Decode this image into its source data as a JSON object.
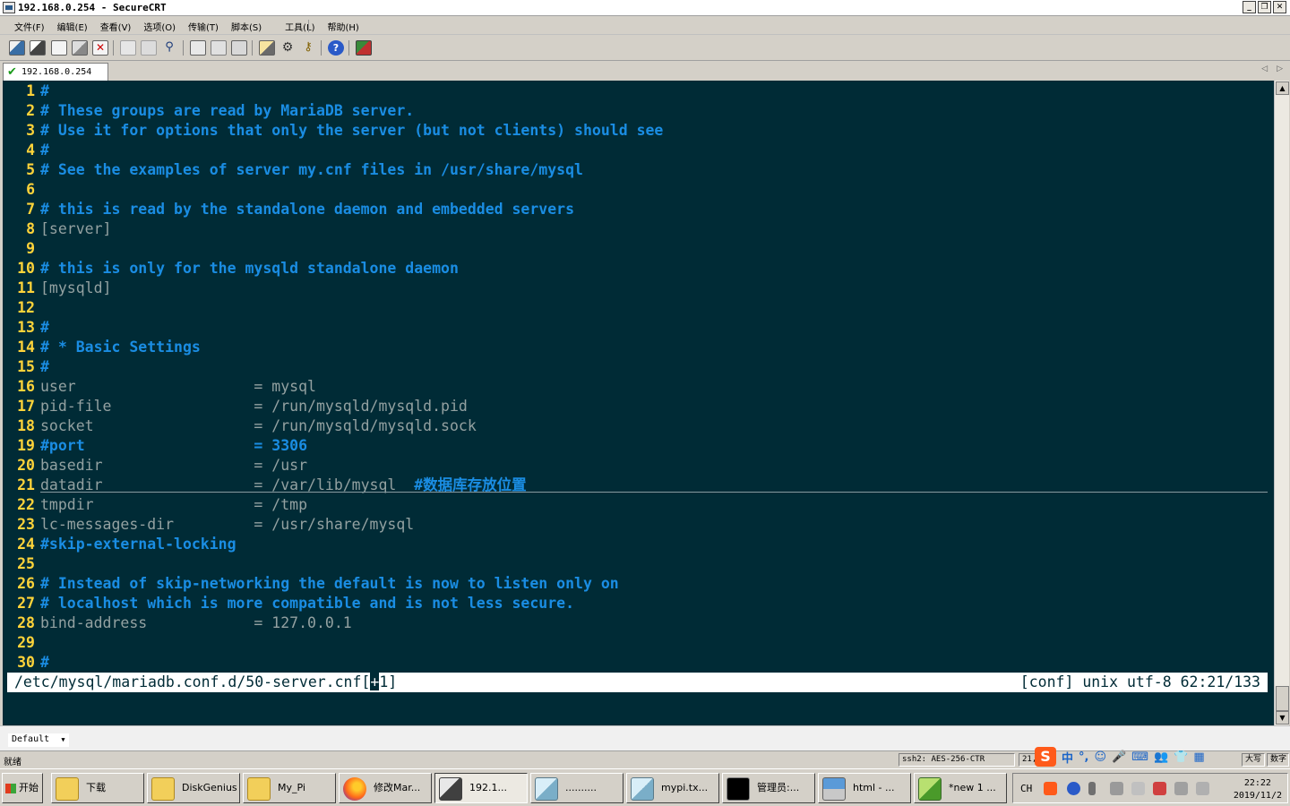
{
  "window": {
    "title": "192.168.0.254 - SecureCRT",
    "controls": [
      "_",
      "❐",
      "✕"
    ]
  },
  "menu": [
    "文件(F)",
    "编辑(E)",
    "查看(V)",
    "选项(O)",
    "传输(T)",
    "脚本(S)",
    "工具(L)",
    "帮助(H)"
  ],
  "toolbar": {
    "icons": [
      "connect-icon",
      "quick-connect-icon",
      "connect-tab-icon",
      "reconnect-icon",
      "disconnect-icon",
      "copy-icon",
      "paste-icon",
      "find-icon",
      "print-icon",
      "print-selection-icon",
      "print-setup-icon",
      "session-options-icon",
      "global-options-icon",
      "key-map-icon",
      "help-icon",
      "sftp-icon"
    ]
  },
  "tab": {
    "label": "192.168.0.254",
    "status_icon": "connected-check-icon"
  },
  "colors": {
    "terminal_bg": "#002b36",
    "line_number": "#ffd43a",
    "comment": "#1a8de3",
    "text": "#93a1a1"
  },
  "editor": {
    "lines": [
      {
        "n": "1",
        "segments": [
          {
            "t": "#",
            "c": "cm"
          }
        ]
      },
      {
        "n": "2",
        "segments": [
          {
            "t": "# These groups are read by MariaDB server.",
            "c": "cm"
          }
        ]
      },
      {
        "n": "3",
        "segments": [
          {
            "t": "# Use it for options that only the server (but not clients) should see",
            "c": "cm"
          }
        ]
      },
      {
        "n": "4",
        "segments": [
          {
            "t": "#",
            "c": "cm"
          }
        ]
      },
      {
        "n": "5",
        "segments": [
          {
            "t": "# See the examples of server my.cnf files in /usr/share/mysql",
            "c": "cm"
          }
        ]
      },
      {
        "n": "6",
        "segments": []
      },
      {
        "n": "7",
        "segments": [
          {
            "t": "# this is read by the standalone daemon and embedded servers",
            "c": "cm"
          }
        ]
      },
      {
        "n": "8",
        "segments": [
          {
            "t": "[server]",
            "c": "kw"
          }
        ]
      },
      {
        "n": "9",
        "segments": []
      },
      {
        "n": "10",
        "segments": [
          {
            "t": "# this is only for the mysqld standalone daemon",
            "c": "cm"
          }
        ]
      },
      {
        "n": "11",
        "segments": [
          {
            "t": "[mysqld]",
            "c": "kw"
          }
        ]
      },
      {
        "n": "12",
        "segments": []
      },
      {
        "n": "13",
        "segments": [
          {
            "t": "#",
            "c": "cm"
          }
        ]
      },
      {
        "n": "14",
        "segments": [
          {
            "t": "# * Basic Settings",
            "c": "cm"
          }
        ]
      },
      {
        "n": "15",
        "segments": [
          {
            "t": "#",
            "c": "cm"
          }
        ]
      },
      {
        "n": "16",
        "segments": [
          {
            "t": "user                    = mysql",
            "c": "kw"
          }
        ]
      },
      {
        "n": "17",
        "segments": [
          {
            "t": "pid-file                = /run/mysqld/mysqld.pid",
            "c": "kw"
          }
        ]
      },
      {
        "n": "18",
        "segments": [
          {
            "t": "socket                  = /run/mysqld/mysqld.sock",
            "c": "kw"
          }
        ]
      },
      {
        "n": "19",
        "segments": [
          {
            "t": "#port                   = 3306",
            "c": "cm"
          }
        ]
      },
      {
        "n": "20",
        "segments": [
          {
            "t": "basedir                 = /usr",
            "c": "kw"
          }
        ]
      },
      {
        "n": "21",
        "segments": [
          {
            "t": "datadir                 = /var/lib/mysql  ",
            "c": "kw"
          },
          {
            "t": "#数据库存放位置",
            "c": "hl"
          }
        ]
      },
      {
        "n": "22",
        "segments": [
          {
            "t": "tmpdir                  = /tmp",
            "c": "kw"
          }
        ]
      },
      {
        "n": "23",
        "segments": [
          {
            "t": "lc-messages-dir         = /usr/share/mysql",
            "c": "kw"
          }
        ]
      },
      {
        "n": "24",
        "segments": [
          {
            "t": "#skip-external-locking",
            "c": "cm"
          }
        ]
      },
      {
        "n": "25",
        "segments": []
      },
      {
        "n": "26",
        "segments": [
          {
            "t": "# Instead of skip-networking the default is now to listen only on",
            "c": "cm"
          }
        ]
      },
      {
        "n": "27",
        "segments": [
          {
            "t": "# localhost which is more compatible and is not less secure.",
            "c": "cm"
          }
        ]
      },
      {
        "n": "28",
        "segments": [
          {
            "t": "bind-address            = 127.0.0.1",
            "c": "kw"
          }
        ]
      },
      {
        "n": "29",
        "segments": []
      },
      {
        "n": "30",
        "segments": [
          {
            "t": "#",
            "c": "cm"
          }
        ]
      }
    ],
    "status_path_before": "/etc/mysql/mariadb.conf.d/50-server.cnf[",
    "status_cursor": "+",
    "status_path_after": "1]",
    "status_right": "[conf] unix utf-8 62:21/133"
  },
  "button_bar": {
    "selected": "Default"
  },
  "statusbar": {
    "ready": "就绪",
    "cipher": "ssh2: AES-256-CTR",
    "position": "21,",
    "caps": "大写",
    "num": "数字"
  },
  "ime": {
    "logo": "S",
    "chars": [
      "中",
      "°,",
      "☺",
      "🎤",
      "⌨",
      "👥",
      "👕",
      "▦"
    ]
  },
  "taskbar": {
    "start": "开始",
    "buttons": [
      {
        "label": "下载",
        "icon": "folder-icon"
      },
      {
        "label": "DiskGenius",
        "icon": "folder-icon"
      },
      {
        "label": "My_Pi",
        "icon": "folder-icon"
      },
      {
        "label": "修改Mar...",
        "icon": "firefox-icon"
      },
      {
        "label": "192.1...",
        "icon": "securecrt-icon"
      },
      {
        "label": "..........",
        "icon": "notepad-icon"
      },
      {
        "label": "mypi.tx...",
        "icon": "notepad-icon"
      },
      {
        "label": "管理员:...",
        "icon": "cmd-icon"
      },
      {
        "label": "html - ...",
        "icon": "lock-icon"
      },
      {
        "label": "*new 1 ...",
        "icon": "notepadpp-icon"
      }
    ],
    "tray_lang": "CH",
    "clock_time": "22:22",
    "clock_date": "2019/11/2"
  }
}
